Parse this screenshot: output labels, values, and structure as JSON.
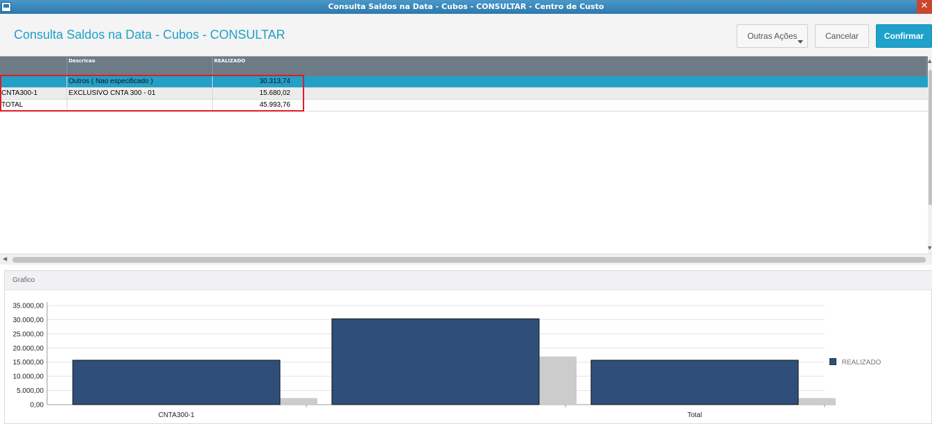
{
  "window": {
    "title": "Consulta Saldos na Data - Cubos - CONSULTAR - Centro de Custo",
    "close_glyph": "✕"
  },
  "header": {
    "title": "Consulta Saldos na Data - Cubos - CONSULTAR",
    "buttons": {
      "other_actions": "Outras Ações",
      "cancel": "Cancelar",
      "confirm": "Confirmar"
    }
  },
  "grid": {
    "columns": [
      "",
      "Descricao",
      "REALIZADO"
    ],
    "rows": [
      {
        "code": "",
        "description": "Outros ( Nao especificado )",
        "realizado": "30.313,74",
        "selected": true
      },
      {
        "code": "CNTA300-1",
        "description": "EXCLUSIVO CNTA 300 - 01",
        "realizado": "15.680,02",
        "selected": false
      },
      {
        "code": "TOTAL",
        "description": "",
        "realizado": "45.993,76",
        "selected": false
      }
    ]
  },
  "chart_panel": {
    "title": "Grafico"
  },
  "chart_data": {
    "type": "bar",
    "categories": [
      "CNTA300-1",
      "",
      "Total"
    ],
    "series": [
      {
        "name": "REALIZADO",
        "values": [
          15680.02,
          30313.74,
          15680.02
        ]
      }
    ],
    "shadow_values": [
      2300,
      17000,
      2300
    ],
    "yticks": [
      "0,00",
      "5.000,00",
      "10.000,00",
      "15.000,00",
      "20.000,00",
      "25.000,00",
      "30.000,00",
      "35.000,00"
    ],
    "ylim": [
      0,
      35000
    ],
    "legend_position": "right",
    "colors": {
      "bar": "#2f4f7a",
      "shadow": "#cccccc",
      "grid": "#e3e3e3"
    }
  }
}
